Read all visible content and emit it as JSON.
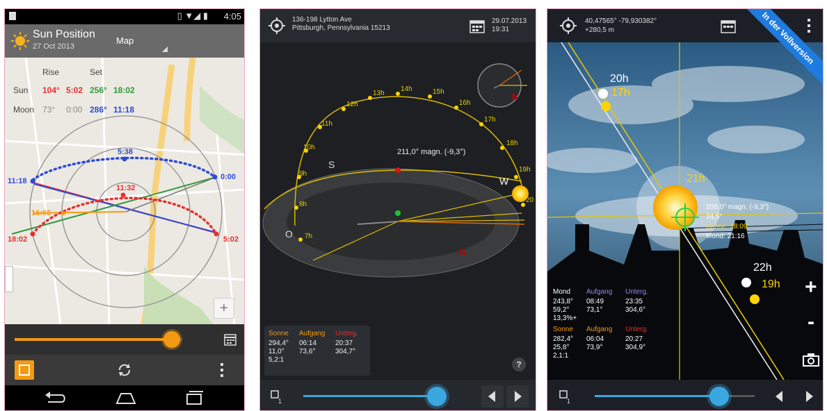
{
  "screen1": {
    "status_time": "4:05",
    "app_title": "Sun Position",
    "app_date": "27 Oct 2013",
    "view_mode": "Map",
    "table": {
      "header_rise": "Rise",
      "header_set": "Set",
      "sun_label": "Sun",
      "sun_rise_az": "104°",
      "sun_rise_time": "5:02",
      "sun_set_az": "256°",
      "sun_set_time": "18:02",
      "moon_label": "Moon",
      "moon_rise_az": "73°",
      "moon_rise_time": "0:00",
      "moon_set_az": "286°",
      "moon_set_time": "11:18"
    },
    "map_labels": {
      "moon_left": "11:18",
      "moon_right": "0:00",
      "moon_top": "5:38",
      "sun_top": "11:32",
      "mid_left": "16:02",
      "sun_left": "18:02",
      "sun_right": "5:02"
    },
    "slider_fraction": 0.94,
    "zoom_plus": "+"
  },
  "screen2": {
    "address_line1": "136-198 Lytton Ave",
    "address_line2": "Pittsburgh, Pennsylvania 15213",
    "date": "29.07.2013",
    "time": "19:31",
    "heading_label": "211,0° magn. (-9,3°)",
    "hour_labels": [
      "7h",
      "8h",
      "9h",
      "10h",
      "11h",
      "12h",
      "13h",
      "14h",
      "15h",
      "16h",
      "17h",
      "18h",
      "19h",
      "20"
    ],
    "dir_S": "S",
    "dir_W": "W",
    "dir_O": "O",
    "dir_N": "N",
    "info": {
      "sun": "Sonne",
      "rise": "Aufgang",
      "set": "Unterg.",
      "r1c1": "294,4°",
      "r1c2": "06:14",
      "r1c3": "20:37",
      "r2c1": "11,0°",
      "r2c2": "73,6°",
      "r2c3": "304,7°",
      "r3c1": "5,2:1"
    },
    "help": "?",
    "slider_fraction": 0.94
  },
  "screen3": {
    "coords": "40,47565° -79,930382°",
    "altitude": "+280,5 m",
    "banner": "In der Vollversion",
    "label_20h": "20h",
    "label_17h": "17h",
    "label_21h": "21h",
    "label_22h": "22h",
    "label_19h": "19h",
    "heading_label": "200,0° magn. (-9,3°)",
    "small_value": "24,5°",
    "sun_line": "Sonne: 18:09",
    "moon_line": "Mond: 21:16",
    "info": {
      "moon": "Mond",
      "rise": "Aufgang",
      "set": "Unterg.",
      "m1c1": "243,8°",
      "m1c2": "08:49",
      "m1c3": "23:35",
      "m2c1": "59,2°",
      "m2c2": "73,1°",
      "m2c3": "304,6°",
      "m3c1": "13,3%+",
      "sun": "Sonne",
      "s1c1": "282,4°",
      "s1c2": "06:04",
      "s1c3": "20:27",
      "s2c1": "25,8°",
      "s2c2": "73,9°",
      "s2c3": "304,9°",
      "s3c1": "2,1:1"
    },
    "zoom_plus": "+",
    "zoom_minus": "-",
    "slider_fraction": 0.78
  },
  "colors": {
    "sun_red": "#e53030",
    "sun_green": "#2e9a3c",
    "moon_blue": "#2d49d6",
    "accent_orange": "#f39a12",
    "slider_blue": "#3aa7e0",
    "yellow": "#ffd400"
  }
}
